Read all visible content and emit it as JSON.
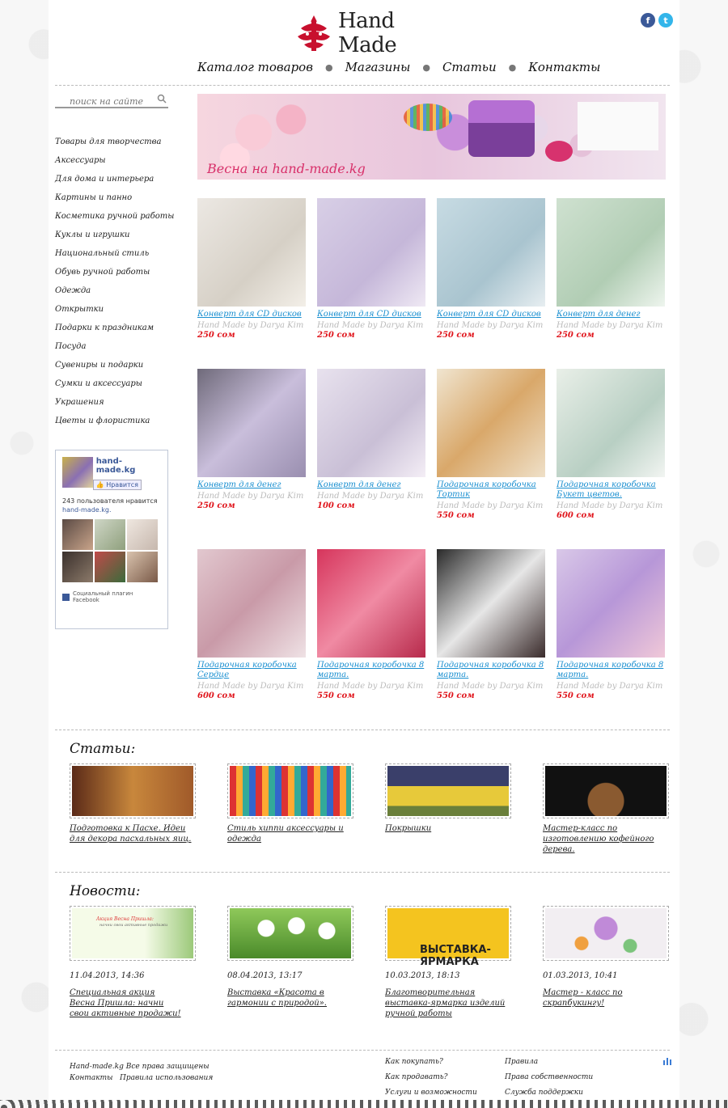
{
  "header": {
    "logo_text": "Hand Made",
    "nav": [
      "Каталог товаров",
      "Магазины",
      "Статьи",
      "Контакты"
    ],
    "social": [
      {
        "name": "facebook",
        "glyph": "f"
      },
      {
        "name": "twitter",
        "glyph": "t"
      }
    ]
  },
  "search": {
    "placeholder": "поиск на сайте"
  },
  "sidebar": {
    "categories": [
      "Товары для творчества",
      "Аксессуары",
      "Для дома и интерьера",
      "Картины и панно",
      "Косметика ручной работы",
      "Куклы и игрушки",
      "Национальный стиль",
      "Обувь ручной работы",
      "Одежда",
      "Открытки",
      "Подарки к праздникам",
      "Посуда",
      "Сувениры и подарки",
      "Сумки и аксессуары",
      "Украшения",
      "Цветы и флористика"
    ],
    "facebook": {
      "page_name": "hand-made.kg",
      "like_label": "Нравится",
      "count_text": "243 пользователя нравится",
      "count_link": "hand-made.kg.",
      "footer_text": "Социальный плагин Facebook"
    }
  },
  "banner": {
    "text": "Весна на hand-made.kg"
  },
  "products": [
    {
      "title": "Конверт для CD дисков",
      "author": "Hand Made by Darya Kim",
      "price": "250 сом"
    },
    {
      "title": "Конверт для CD дисков",
      "author": "Hand Made by Darya Kim",
      "price": "250 сом"
    },
    {
      "title": "Конверт для CD дисков",
      "author": "Hand Made by Darya Kim",
      "price": "250 сом"
    },
    {
      "title": "Конверт для денег",
      "author": "Hand Made by Darya Kim",
      "price": "250 сом"
    },
    {
      "title": "Конверт для денег",
      "author": "Hand Made by Darya Kim",
      "price": "250 сом"
    },
    {
      "title": "Конверт для денег",
      "author": "Hand Made by Darya Kim",
      "price": "100 сом"
    },
    {
      "title": "Подарочная коробочка Тортик",
      "author": "Hand Made by Darya Kim",
      "price": "550 сом"
    },
    {
      "title": "Подарочная коробочка Букет цветов.",
      "author": "Hand Made by Darya Kim",
      "price": "600 сом"
    },
    {
      "title": "Подарочная коробочка Сердце",
      "author": "Hand Made by Darya Kim",
      "price": "600 сом"
    },
    {
      "title": "Подарочная коробочка 8 марта.",
      "author": "Hand Made by Darya Kim",
      "price": "550 сом"
    },
    {
      "title": "Подарочная коробочка 8 марта.",
      "author": "Hand Made by Darya Kim",
      "price": "550 сом"
    },
    {
      "title": "Подарочная коробочка 8 марта.",
      "author": "Hand Made by Darya Kim",
      "price": "550 сом"
    }
  ],
  "articles": {
    "heading": "Статьи:",
    "items": [
      "Подготовка к Пасхе. Идеи для декора пасхальных яиц.",
      "Стиль хиппи аксессуары и одежда",
      "Покрышки",
      "Мастер-класс по изготовлению кофейного дерева."
    ]
  },
  "news": {
    "heading": "Новости:",
    "items": [
      {
        "date": "11.04.2013, 14:36",
        "title": "Специальная акция Весна Пришла: начни свои активные продажи!"
      },
      {
        "date": "08.04.2013, 13:17",
        "title": "Выставка «Красота в гармонии с природой»."
      },
      {
        "date": "10.03.2013, 18:13",
        "title": "Благотворительная выставка-ярмарка изделий ручной работы"
      },
      {
        "date": "01.03.2013, 10:41",
        "title": "Мастер - класс по скрапбукингу!"
      }
    ],
    "image_texts": {
      "promo_title": "Акция Весна Пришла:",
      "promo_sub": "начни свои активные продажи",
      "fair": "ВЫСТАВКА-ЯРМАРКА"
    }
  },
  "footer": {
    "copyright": "Hand-made.kg Все права защищены",
    "links_left": [
      "Контакты",
      "Правила использования"
    ],
    "col1": [
      "Как покупать?",
      "Как продавать?",
      "Услуги и возможности"
    ],
    "col2": [
      "Правила",
      "Права собственности",
      "Служба поддержки"
    ]
  }
}
